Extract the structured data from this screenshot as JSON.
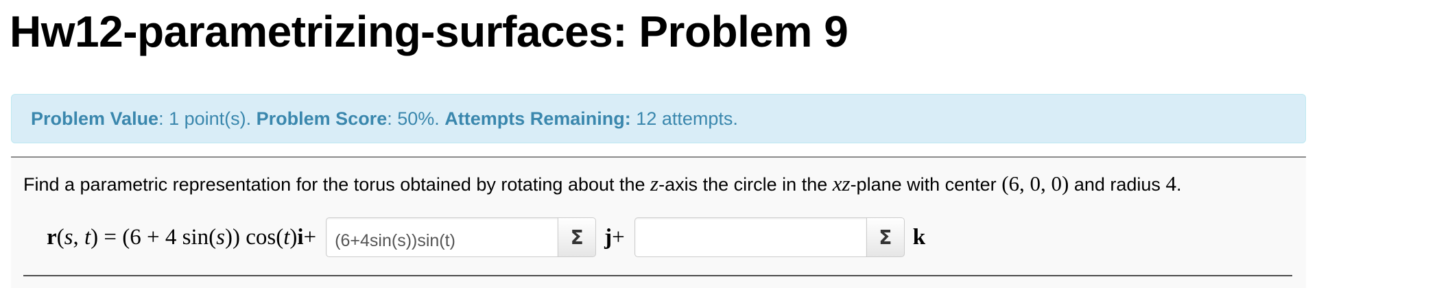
{
  "page_title": "Hw12-parametrizing-surfaces: Problem 9",
  "problem_info": {
    "value_label": "Problem Value",
    "value_text": ": 1 point(s). ",
    "score_label": "Problem Score",
    "score_text": ": 50%. ",
    "attempts_label": "Attempts Remaining:",
    "attempts_text": " 12 attempts."
  },
  "problem": {
    "text_1": "Find a parametric representation for the torus obtained by rotating about the ",
    "axis_var": "z",
    "text_2": "-axis the circle in the ",
    "plane_var": "xz",
    "text_3": "-plane with center ",
    "center": "(6, 0, 0)",
    "text_4": " and radius ",
    "radius": "4",
    "text_5": "."
  },
  "answer_row": {
    "r_symbol": "r",
    "r_args_open": "(",
    "r_arg_s": "s",
    "r_comma": ", ",
    "r_arg_t": "t",
    "r_args_close": ")",
    "x_expr_1": " = (6 + 4 sin(",
    "x_expr_s": "s",
    "x_expr_2": ")) cos(",
    "x_expr_t": "t",
    "x_expr_3": ")",
    "i_vec": "i",
    "plus_1": "+",
    "j_input_value": "(6+4sin(s))sin(t)",
    "j_equation_button": "Σ",
    "j_vec": "j",
    "plus_2": "+",
    "k_input_value": "",
    "k_equation_button": "Σ",
    "k_vec": "k"
  },
  "colors": {
    "info_background": "#d9edf7",
    "info_text": "#3a87ad",
    "problem_background": "#f9f9f9"
  }
}
